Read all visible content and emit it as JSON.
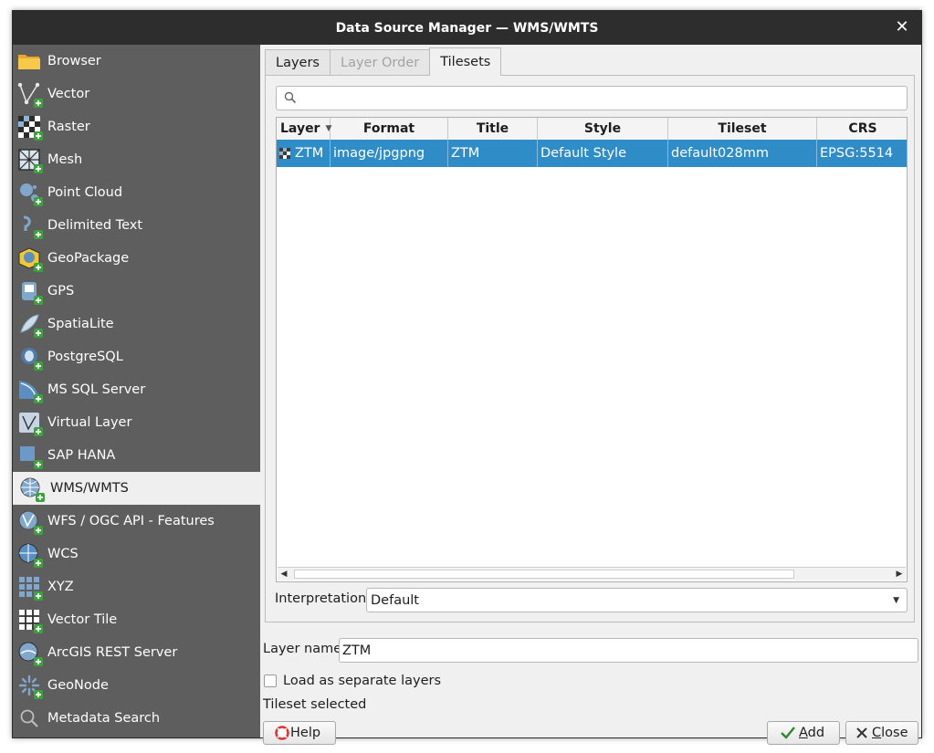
{
  "window": {
    "title": "Data Source Manager — WMS/WMTS",
    "close_glyph": "✕"
  },
  "sidebar": {
    "items": [
      {
        "label": "Browser",
        "icon": "folder-icon"
      },
      {
        "label": "Vector",
        "icon": "vector-icon"
      },
      {
        "label": "Raster",
        "icon": "raster-icon"
      },
      {
        "label": "Mesh",
        "icon": "mesh-icon"
      },
      {
        "label": "Point Cloud",
        "icon": "point-cloud-icon"
      },
      {
        "label": "Delimited Text",
        "icon": "delimited-text-icon"
      },
      {
        "label": "GeoPackage",
        "icon": "geopackage-icon"
      },
      {
        "label": "GPS",
        "icon": "gps-icon"
      },
      {
        "label": "SpatiaLite",
        "icon": "spatialite-icon"
      },
      {
        "label": "PostgreSQL",
        "icon": "postgresql-icon"
      },
      {
        "label": "MS SQL Server",
        "icon": "mssql-icon"
      },
      {
        "label": "Virtual Layer",
        "icon": "virtual-layer-icon"
      },
      {
        "label": "SAP HANA",
        "icon": "sap-hana-icon"
      },
      {
        "label": "WMS/WMTS",
        "icon": "wms-icon",
        "selected": true
      },
      {
        "label": "WFS / OGC API - Features",
        "icon": "wfs-icon"
      },
      {
        "label": "WCS",
        "icon": "wcs-icon"
      },
      {
        "label": "XYZ",
        "icon": "xyz-icon"
      },
      {
        "label": "Vector Tile",
        "icon": "vector-tile-icon"
      },
      {
        "label": "ArcGIS REST Server",
        "icon": "arcgis-icon"
      },
      {
        "label": "GeoNode",
        "icon": "geonode-icon"
      },
      {
        "label": "Metadata Search",
        "icon": "metadata-search-icon"
      }
    ]
  },
  "tabs": [
    {
      "label": "Layers",
      "state": "normal"
    },
    {
      "label": "Layer Order",
      "state": "disabled"
    },
    {
      "label": "Tilesets",
      "state": "active"
    }
  ],
  "search": {
    "placeholder": ""
  },
  "table": {
    "columns": [
      "Layer",
      "Format",
      "Title",
      "Style",
      "Tileset",
      "CRS"
    ],
    "rows": [
      {
        "layer": "ZTM",
        "format": "image/jpgpng",
        "title": "ZTM",
        "style": "Default Style",
        "tileset": "default028mm",
        "crs": "EPSG:5514",
        "selected": true
      }
    ]
  },
  "interpretation": {
    "label": "Interpretation",
    "value": "Default"
  },
  "layer_name": {
    "label": "Layer name",
    "value": "ZTM"
  },
  "load_separate": {
    "label": "Load as separate layers",
    "checked": false
  },
  "status_text": "Tileset selected",
  "buttons": {
    "help": "Help",
    "add_mnemonic": "A",
    "add_rest": "dd",
    "close_mnemonic": "C",
    "close_rest": "lose"
  },
  "colors": {
    "sidebar_bg": "#5e5e5e",
    "selection": "#308cc6",
    "titlebar": "#2d2d2d"
  }
}
